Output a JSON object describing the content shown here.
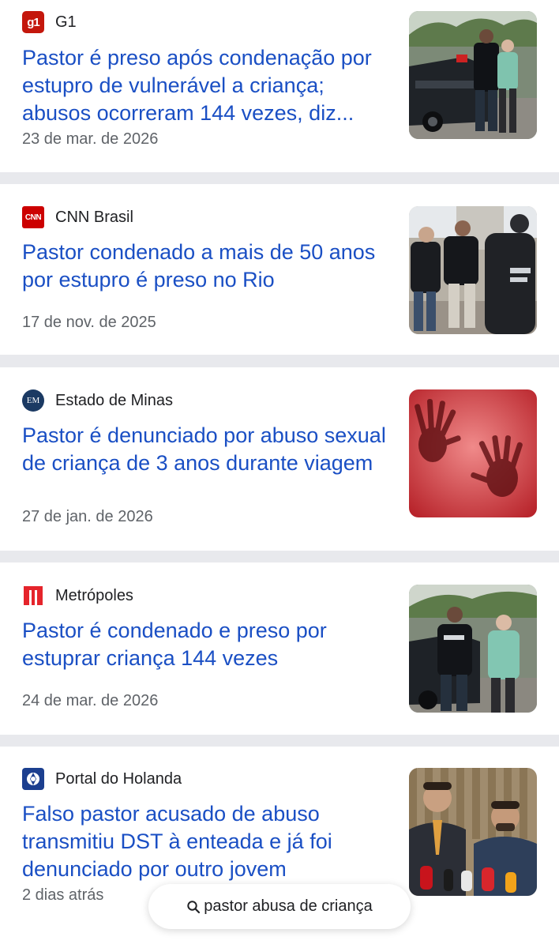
{
  "results": [
    {
      "source": "G1",
      "logo_text": "g1",
      "logo_color": "#c4170c",
      "title": "Pastor é preso após condenação por estupro de vulnerável a criança; abusos ocorreram 144 vezes, diz...",
      "date": "23 de mar. de 2026",
      "thumb": "police-car-arrest-photo"
    },
    {
      "source": "CNN Brasil",
      "logo_text": "CNN",
      "logo_color": "#cc0000",
      "title": "Pastor condenado a mais de 50 anos por estupro é preso no Rio",
      "date": "17 de nov. de 2025",
      "thumb": "police-escort-photo"
    },
    {
      "source": "Estado de Minas",
      "logo_text": "EM",
      "logo_color": "#1b3a63",
      "title": "Pastor é denunciado por abuso sexual de criança de 3 anos durante viagem",
      "date": "27 de jan. de 2026",
      "thumb": "red-hands-photo"
    },
    {
      "source": "Metrópoles",
      "logo_text": "M",
      "logo_color": "#e5242b",
      "title": "Pastor é condenado e preso por estuprar criança 144 vezes",
      "date": "24 de mar. de 2026",
      "thumb": "police-car-arrest-photo"
    },
    {
      "source": "Portal do Holanda",
      "logo_text": "",
      "logo_color": "#1c3f8f",
      "title": "Falso pastor acusado de abuso transmitiu DST à enteada e já foi denunciado por outro jovem",
      "date": "2 dias atrás",
      "thumb": "press-conference-photo"
    }
  ],
  "search": {
    "query": "pastor abusa de criança",
    "icon": "search-icon"
  }
}
